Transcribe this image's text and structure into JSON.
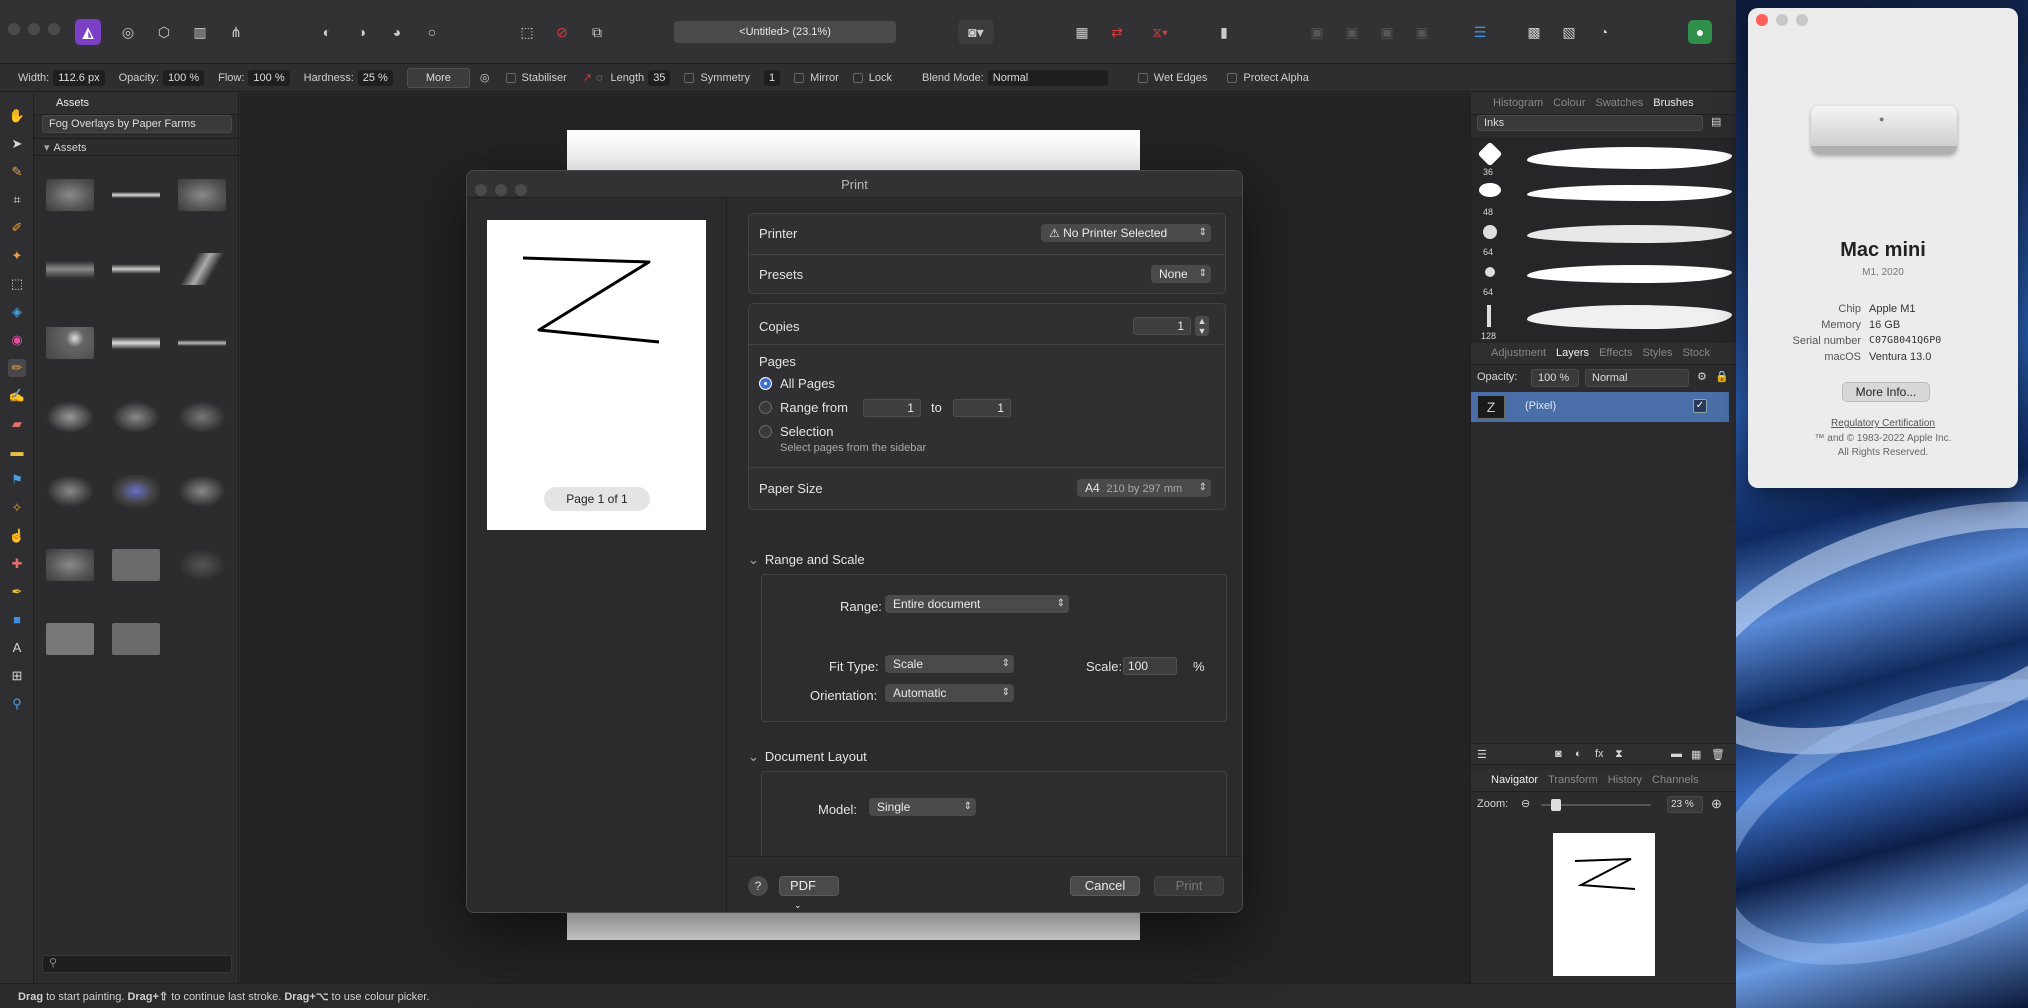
{
  "toolbar": {
    "document_title": "<Untitled> (23.1%)"
  },
  "context_bar": {
    "width_label": "Width:",
    "width_value": "112.6 px",
    "opacity_label": "Opacity:",
    "opacity_value": "100 %",
    "flow_label": "Flow:",
    "flow_value": "100 %",
    "hardness_label": "Hardness:",
    "hardness_value": "25 %",
    "more_label": "More",
    "stabiliser_label": "Stabiliser",
    "length_label": "Length",
    "length_value": "35",
    "symmetry_label": "Symmetry",
    "symmetry_value": "1",
    "mirror_label": "Mirror",
    "lock_label": "Lock",
    "blend_mode_label": "Blend Mode:",
    "blend_mode_value": "Normal",
    "wet_edges_label": "Wet Edges",
    "protect_alpha_label": "Protect Alpha"
  },
  "assets_panel": {
    "tab_label": "Assets",
    "category_value": "Fog Overlays by Paper Farms",
    "section_label": "Assets"
  },
  "right_panel": {
    "top_tabs": [
      "Histogram",
      "Colour",
      "Swatches",
      "Brushes"
    ],
    "brush_category": "Inks",
    "brush_sizes": [
      "36",
      "48",
      "64",
      "64",
      "128"
    ],
    "layer_tabs": [
      "Adjustment",
      "Layers",
      "Effects",
      "Styles",
      "Stock"
    ],
    "opacity_label": "Opacity:",
    "opacity_value": "100 %",
    "blend_value": "Normal",
    "layer_name": "(Pixel)",
    "nav_tabs": [
      "Navigator",
      "Transform",
      "History",
      "Channels"
    ],
    "zoom_label": "Zoom:",
    "zoom_value": "23 %"
  },
  "status_bar": {
    "part1_bold": "Drag",
    "part1": " to start painting. ",
    "part2_bold": "Drag+⇧",
    "part2": " to continue last stroke. ",
    "part3_bold": "Drag+⌥",
    "part3": " to use colour picker."
  },
  "print_dialog": {
    "title": "Print",
    "page_indicator": "Page 1 of 1",
    "printer_label": "Printer",
    "printer_value": "No Printer Selected",
    "presets_label": "Presets",
    "presets_value": "None",
    "copies_label": "Copies",
    "copies_value": "1",
    "pages_label": "Pages",
    "all_pages_label": "All Pages",
    "range_from_label": "Range from",
    "range_from_value": "1",
    "range_to_label": "to",
    "range_to_value": "1",
    "selection_label": "Selection",
    "selection_hint": "Select pages from the sidebar",
    "paper_size_label": "Paper Size",
    "paper_size_value": "A4",
    "paper_size_detail": "210 by 297 mm",
    "range_scale_header": "Range and Scale",
    "range_label": "Range:",
    "range_value": "Entire document",
    "fit_type_label": "Fit Type:",
    "fit_type_value": "Scale",
    "scale_label": "Scale:",
    "scale_value": "100",
    "scale_unit": "%",
    "orientation_label": "Orientation:",
    "orientation_value": "Automatic",
    "doc_layout_header": "Document Layout",
    "model_label": "Model:",
    "model_value": "Single",
    "help_label": "?",
    "pdf_label": "PDF",
    "cancel_label": "Cancel",
    "print_label": "Print"
  },
  "about_mac": {
    "model": "Mac mini",
    "subtitle": "M1, 2020",
    "specs": [
      {
        "k": "Chip",
        "v": "Apple M1"
      },
      {
        "k": "Memory",
        "v": "16 GB"
      },
      {
        "k": "Serial number",
        "v": "C07G8041Q6P0"
      },
      {
        "k": "macOS",
        "v": "Ventura 13.0"
      }
    ],
    "more_info": "More Info...",
    "regulatory": "Regulatory Certification",
    "copyright_1": "™ and © 1983-2022 Apple Inc.",
    "copyright_2": "All Rights Reserved."
  },
  "colors": {
    "accent": "#3b6fd8",
    "affinity_logo": "#7a3fc4",
    "selected_layer": "#4a6fa8"
  }
}
